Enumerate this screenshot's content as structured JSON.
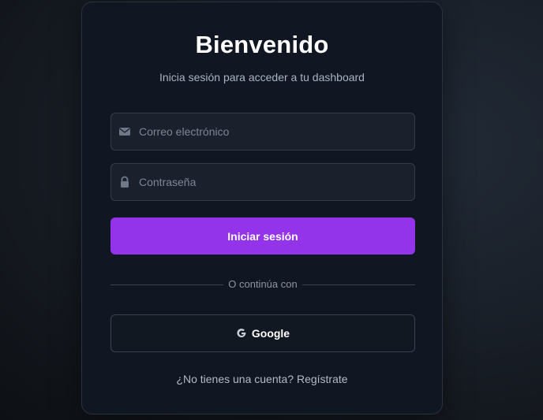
{
  "header": {
    "title": "Bienvenido",
    "subtitle": "Inicia sesión para acceder a tu dashboard"
  },
  "form": {
    "email": {
      "value": "",
      "placeholder": "Correo electrónico",
      "icon": "envelope-icon"
    },
    "password": {
      "value": "",
      "placeholder": "Contraseña",
      "icon": "lock-icon"
    },
    "submit_label": "Iniciar sesión"
  },
  "divider": {
    "label": "O continúa con"
  },
  "social": {
    "google_label": "Google",
    "google_icon": "google-icon"
  },
  "footer": {
    "question": "¿No tienes una cuenta?",
    "signup_link": "Regístrate"
  },
  "colors": {
    "accent": "#9333ea",
    "card_background": "#111722",
    "input_background": "#1a212d"
  }
}
